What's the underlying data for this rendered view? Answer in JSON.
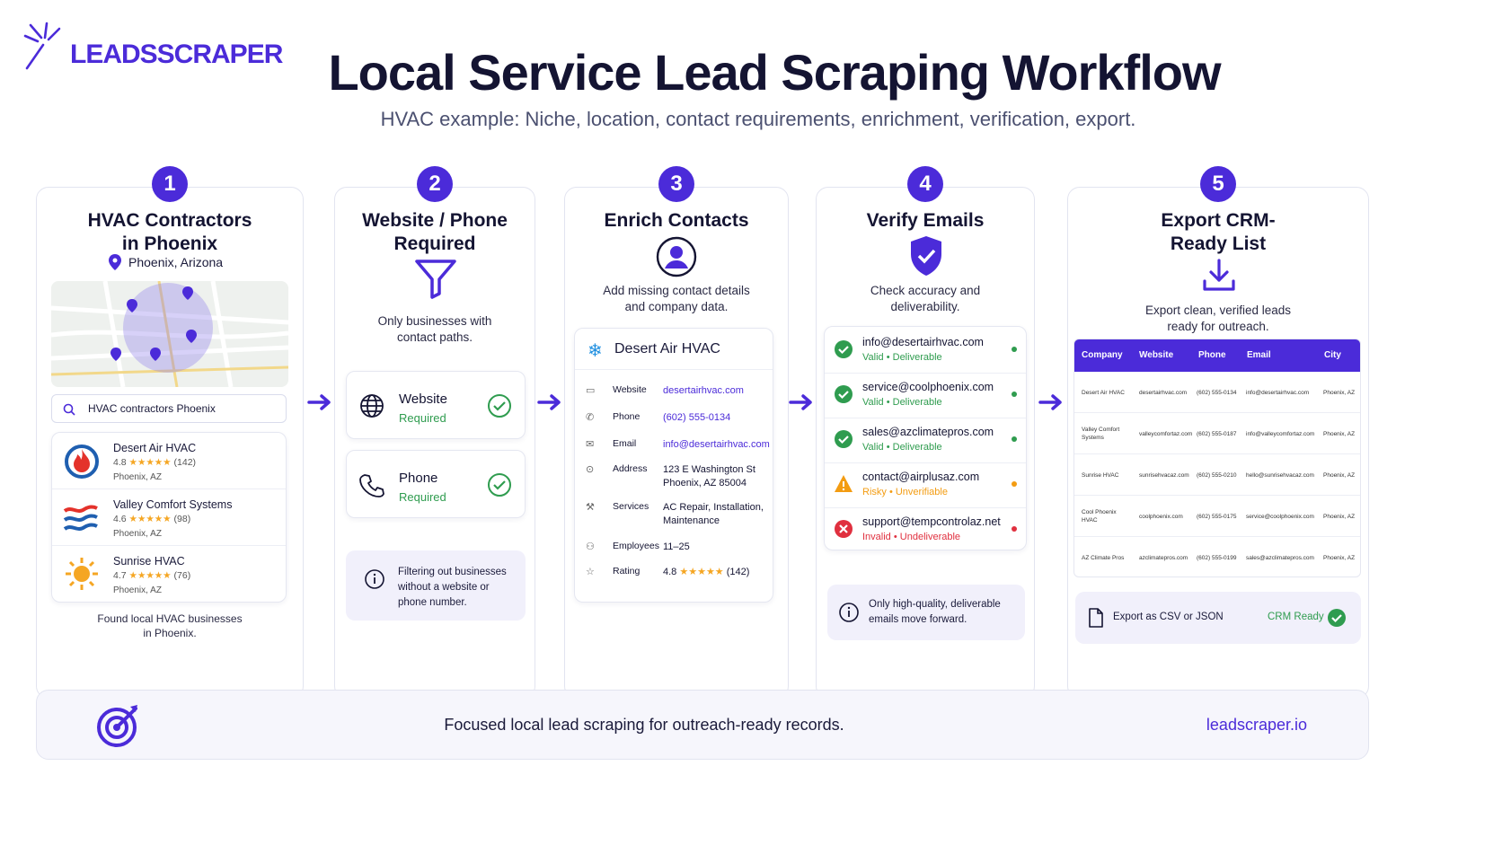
{
  "brand": {
    "name": "LEADSSCRAPER",
    "accent": "#4b2bd9"
  },
  "header": {
    "title": "Local Service Lead Scraping Workflow",
    "subtitle": "HVAC example: Niche, location, contact requirements, enrichment, verification, export."
  },
  "steps": [
    {
      "number": "1",
      "title_line1": "HVAC Contractors",
      "title_line2": "in Phoenix",
      "location": "Phoenix, Arizona",
      "search_value": "HVAC contractors Phoenix",
      "businesses": [
        {
          "name": "Desert Air HVAC",
          "rating": "4.8",
          "reviews": "(142)",
          "location": "Phoenix, AZ"
        },
        {
          "name": "Valley Comfort Systems",
          "rating": "4.6",
          "reviews": "(98)",
          "location": "Phoenix, AZ"
        },
        {
          "name": "Sunrise HVAC",
          "rating": "4.7",
          "reviews": "(76)",
          "location": "Phoenix, AZ"
        }
      ],
      "caption_line1": "Found local HVAC businesses",
      "caption_line2": "in Phoenix."
    },
    {
      "number": "2",
      "title_line1": "Website / Phone",
      "title_line2": "Required",
      "desc_line1": "Only businesses with",
      "desc_line2": "contact paths.",
      "requirements": [
        {
          "label": "Website",
          "status": "Required"
        },
        {
          "label": "Phone",
          "status": "Required"
        }
      ],
      "note_line1": "Filtering out businesses",
      "note_line2": "without a website or",
      "note_line3": "phone number."
    },
    {
      "number": "3",
      "title": "Enrich Contacts",
      "desc_line1": "Add missing contact details",
      "desc_line2": "and company data.",
      "company": "Desert Air HVAC",
      "fields": [
        {
          "key": "Website",
          "value": "desertairhvac.com",
          "value2": ""
        },
        {
          "key": "Phone",
          "value": "(602) 555-0134",
          "value2": ""
        },
        {
          "key": "Email",
          "value": "info@desertairhvac.com",
          "value2": ""
        },
        {
          "key": "Address",
          "value": "123 E Washington St",
          "value2": "Phoenix, AZ 85004"
        },
        {
          "key": "Services",
          "value": "AC Repair, Installation,",
          "value2": "Maintenance"
        },
        {
          "key": "Employees",
          "value": "11–25",
          "value2": ""
        },
        {
          "key": "Rating",
          "value": "4.8",
          "value2": "(142)"
        }
      ]
    },
    {
      "number": "4",
      "title": "Verify Emails",
      "desc_line1": "Check accuracy and",
      "desc_line2": "deliverability.",
      "emails": [
        {
          "address": "info@desertairhvac.com",
          "state": "Valid",
          "detail": "Deliverable",
          "color": "#2f9c4f"
        },
        {
          "address": "service@coolphoenix.com",
          "state": "Valid",
          "detail": "Deliverable",
          "color": "#2f9c4f"
        },
        {
          "address": "sales@azclimatepros.com",
          "state": "Valid",
          "detail": "Deliverable",
          "color": "#2f9c4f"
        },
        {
          "address": "contact@airplusaz.com",
          "state": "Risky",
          "detail": "Unverifiable",
          "color": "#f39c12"
        },
        {
          "address": "support@tempcontrolaz.net",
          "state": "Invalid",
          "detail": "Undeliverable",
          "color": "#e0303f"
        }
      ],
      "note_line1": "Only high-quality, deliverable",
      "note_line2": "emails move forward."
    },
    {
      "number": "5",
      "title_line1": "Export CRM-",
      "title_line2": "Ready List",
      "desc_line1": "Export clean, verified leads",
      "desc_line2": "ready for outreach.",
      "columns": [
        "Company",
        "Website",
        "Phone",
        "Email",
        "City"
      ],
      "rows": [
        {
          "company": "Desert Air HVAC",
          "website": "desertairhvac.com",
          "phone": "(602) 555-0134",
          "email": "info@desertairhvac.com",
          "city": "Phoenix, AZ"
        },
        {
          "company": "Valley Comfort Systems",
          "website": "valleycomfortaz.com",
          "phone": "(602) 555-0187",
          "email": "info@valleycomfortaz.com",
          "city": "Phoenix, AZ"
        },
        {
          "company": "Sunrise HVAC",
          "website": "sunrisehvacaz.com",
          "phone": "(602) 555-0210",
          "email": "hello@sunrisehvacaz.com",
          "city": "Phoenix, AZ"
        },
        {
          "company": "Cool Phoenix HVAC",
          "website": "coolphoenix.com",
          "phone": "(602) 555-0175",
          "email": "service@coolphoenix.com",
          "city": "Phoenix, AZ"
        },
        {
          "company": "AZ Climate Pros",
          "website": "azclimatepros.com",
          "phone": "(602) 555-0199",
          "email": "sales@azclimatepros.com",
          "city": "Phoenix, AZ"
        }
      ],
      "export_label": "Export as CSV or JSON",
      "crm_label": "CRM Ready"
    }
  ],
  "footer": {
    "tagline": "Focused local lead scraping for outreach-ready records.",
    "url": "leadscraper.io"
  }
}
